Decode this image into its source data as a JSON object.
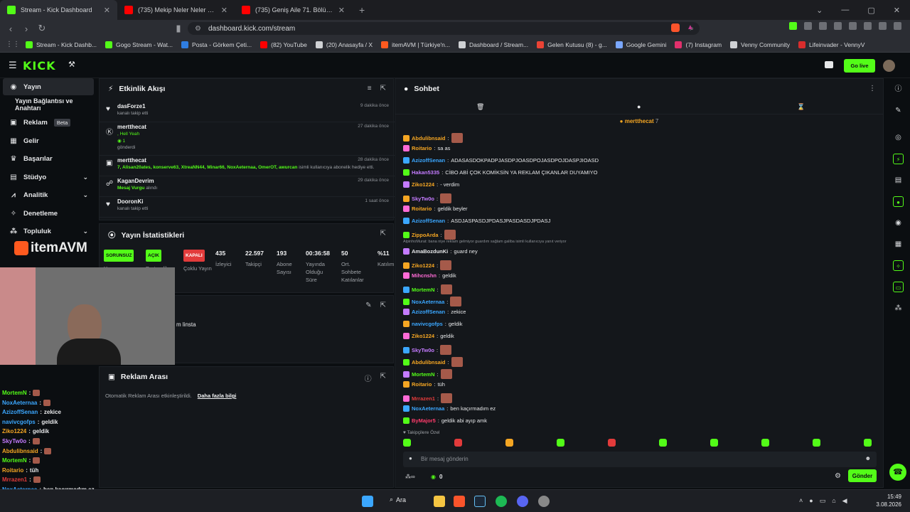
{
  "tabs": [
    {
      "label": "Stream - Kick Dashboard",
      "color": "#53fc18",
      "active": true
    },
    {
      "label": "(735) Mekip Neler Neler 83.Bölüm İz...",
      "color": "#ff0000",
      "active": false
    },
    {
      "label": "(735) Geniş Aile 71. Bölüm (İyileştirilm...",
      "color": "#ff0000",
      "active": false
    }
  ],
  "address": {
    "url": "dashboard.kick.com/stream"
  },
  "bookmarks": [
    {
      "label": "Stream - Kick Dashb...",
      "color": "#53fc18"
    },
    {
      "label": "Gogo Stream - Wat...",
      "color": "#53fc18"
    },
    {
      "label": "Posta - Görkem Çeti...",
      "color": "#2f7de1"
    },
    {
      "label": "(82) YouTube",
      "color": "#ff0000"
    },
    {
      "label": "(20) Anasayfa / X",
      "color": "#cfd1d4"
    },
    {
      "label": "itemAVM | Türkiye'n...",
      "color": "#ff5a1f"
    },
    {
      "label": "Dashboard / Stream...",
      "color": "#cfd1d4"
    },
    {
      "label": "Gelen Kutusu (8) - g...",
      "color": "#ea4335"
    },
    {
      "label": "Google Gemini",
      "color": "#7aa7ff"
    },
    {
      "label": "(7) Instagram",
      "color": "#e1306c"
    },
    {
      "label": "Venny Community",
      "color": "#cfd1d4"
    },
    {
      "label": "Lifeinvader - VennyV",
      "color": "#d92d2d"
    }
  ],
  "header": {
    "logo": "KICK",
    "go_live": "Go live"
  },
  "sidebar": {
    "items": [
      {
        "label": "Yayın",
        "icon": "broadcast-icon"
      },
      {
        "label": "Yayın Bağlantısı ve Anahtarı",
        "icon": ""
      },
      {
        "label": "Reklam",
        "icon": "ad-icon",
        "badge": "Beta"
      },
      {
        "label": "Gelir",
        "icon": "revenue-icon"
      },
      {
        "label": "Başarılar",
        "icon": "trophy-icon"
      },
      {
        "label": "Stüdyo",
        "icon": "studio-icon"
      },
      {
        "label": "Analitik",
        "icon": "analytics-icon"
      },
      {
        "label": "Denetleme",
        "icon": "moderation-icon"
      },
      {
        "label": "Topluluk",
        "icon": "community-icon"
      }
    ]
  },
  "activity": {
    "title": "Etkinlik Akışı",
    "events": [
      {
        "name": "dasForze1",
        "sub": "kanalı takip etti",
        "time": "9 dakika önce",
        "icon": "heart-icon"
      },
      {
        "name": "mertthecat",
        "sub": ", Hell Yeah",
        "sub2": "1",
        "sub3": "gönderdi",
        "time": "27 dakika önce",
        "icon": "kick-icon"
      },
      {
        "name": "mertthecat",
        "sub": "7, Alisan20ates, konserve63, XtreaNN44, Minar66, NoxAeternaa, OmerOT, awurcan",
        "sub_tail": "isimli kullanıcıya abonelik hediye etti.",
        "time": "28 dakika önce",
        "icon": "gift-icon"
      },
      {
        "name": "KaganDevrim",
        "sub": "Mesaj Vurgu",
        "sub_tail": "alındı",
        "time": "29 dakika önce",
        "icon": "highlight-icon"
      },
      {
        "name": "DooronKi",
        "sub": "kanalı takip etti",
        "time": "1 saat önce",
        "icon": "heart-icon"
      }
    ]
  },
  "stats": {
    "title": "Yayın İstatistikleri",
    "pills": [
      {
        "text": "SORUNSUZ",
        "color": "#53fc18",
        "label": "Yayın"
      },
      {
        "text": "AÇIK",
        "color": "#53fc18",
        "label": "Partnerlik"
      },
      {
        "text": "KAPALI",
        "color": "#e23b3b",
        "label": "Çoklu Yayın"
      }
    ],
    "values": [
      {
        "v": "435",
        "label": "İzleyici"
      },
      {
        "v": "22.597",
        "label": "Takipçi"
      },
      {
        "v": "193",
        "label": "Abone Sayısı"
      },
      {
        "v": "00:36:58",
        "label": "Yayında Olduğu Süre"
      },
      {
        "v": "50",
        "label": "Ort. Sohbete Katılanlar"
      },
      {
        "v": "%11",
        "label": "Katılım"
      }
    ]
  },
  "info_panel": {
    "text": "m linsta"
  },
  "ads": {
    "title": "Reklam Arası",
    "text": "Otomatik Reklam Arası etkinleştirildi.",
    "link": "Daha fazla bilgi"
  },
  "chat": {
    "title": "Sohbet",
    "pinned": "mertthecat",
    "pinned_count": "7",
    "input_placeholder": "Bir mesaj gönderin",
    "send": "Gönder",
    "followers_only": "Takipçilere Özel",
    "count": "0",
    "notice": "AlpinhoMurat: bana niye reklam gelmiyor guardım sağlam galiba isimli kullanıcıya yanıt veriyor",
    "messages": [
      {
        "user": "Abdulibnsaid",
        "color": "#f5a623",
        "text": "",
        "emote": true
      },
      {
        "user": "Roitario",
        "color": "#f5a623",
        "text": "sa as"
      },
      {
        "user": "AzizoffSenan",
        "color": "#3ba7ff",
        "text": "ADASASDOKPADPJASDPJOASDPOJASDPOJDASPJIOASD"
      },
      {
        "user": "Hakan5335",
        "color": "#c47bff",
        "text": "CİBO ABİ ÇOK KOMİKSİN YA REKLAM ÇIKANLAR DUYAMIYO"
      },
      {
        "user": "Ziko1224",
        "color": "#f5a623",
        "text": "- verdim"
      },
      {
        "user": "SkyTw0o",
        "color": "#c47bff",
        "text": "",
        "emote": true
      },
      {
        "user": "Roitario",
        "color": "#f5a623",
        "text": "geldik beyler"
      },
      {
        "user": "AzizoffSenan",
        "color": "#3ba7ff",
        "text": "ASDJASPASDJPDASJPASDASDJPDASJ"
      },
      {
        "user": "ZippoArda",
        "color": "#f5a623",
        "text": "",
        "emote": true
      },
      {
        "user": "AmaBozdunKi",
        "color": "#e6e7e9",
        "text": "guard ney"
      },
      {
        "user": "Ziko1224",
        "color": "#f5a623",
        "text": "",
        "emote": true
      },
      {
        "user": "Mihcnshn",
        "color": "#ff6bd6",
        "text": "geldik"
      },
      {
        "user": "MortemN",
        "color": "#53fc18",
        "text": "",
        "emote": true
      },
      {
        "user": "NoxAeternaa",
        "color": "#3ba7ff",
        "text": "",
        "emote": true
      },
      {
        "user": "AzizoffSenan",
        "color": "#3ba7ff",
        "text": "zekice"
      },
      {
        "user": "navivcgofps",
        "color": "#3ba7ff",
        "text": "geldik"
      },
      {
        "user": "Ziko1224",
        "color": "#f5a623",
        "text": "geldik"
      },
      {
        "user": "SkyTw0o",
        "color": "#c47bff",
        "text": "",
        "emote": true
      },
      {
        "user": "Abdulibnsaid",
        "color": "#f5a623",
        "text": "",
        "emote": true
      },
      {
        "user": "MortemN",
        "color": "#53fc18",
        "text": "",
        "emote": true
      },
      {
        "user": "Roitario",
        "color": "#f5a623",
        "text": "tüh"
      },
      {
        "user": "Mrrazen1",
        "color": "#e23b3b",
        "text": "",
        "emote": true
      },
      {
        "user": "NoxAeternaa",
        "color": "#3ba7ff",
        "text": "ben kaçırmadım ez"
      },
      {
        "user": "ByMajor5",
        "color": "#ff3b6b",
        "text": "geldik abi ayıp amk"
      }
    ]
  },
  "overlay": {
    "brand": "itemAVM",
    "chat": [
      {
        "user": "MortemN",
        "color": "#53fc18",
        "text": ""
      },
      {
        "user": "NoxAeternaa",
        "color": "#3ba7ff",
        "text": ""
      },
      {
        "user": "AzizoffSenan",
        "color": "#3ba7ff",
        "text": "zekice"
      },
      {
        "user": "navivcgofps",
        "color": "#3ba7ff",
        "text": "geldik"
      },
      {
        "user": "Ziko1224",
        "color": "#f5a623",
        "text": "geldik"
      },
      {
        "user": "SkyTw0o",
        "color": "#c47bff",
        "text": ""
      },
      {
        "user": "Abdulibnsaid",
        "color": "#f5a623",
        "text": ""
      },
      {
        "user": "MortemN",
        "color": "#53fc18",
        "text": ""
      },
      {
        "user": "Roitario",
        "color": "#f5a623",
        "text": "tüh"
      },
      {
        "user": "Mrrazen1",
        "color": "#e23b3b",
        "text": ""
      },
      {
        "user": "NoxAeternaa",
        "color": "#3ba7ff",
        "text": "ben kaçırmadım ez"
      }
    ]
  },
  "taskbar": {
    "search": "Ara",
    "time": "15:49",
    "date": "3.08.2026"
  }
}
